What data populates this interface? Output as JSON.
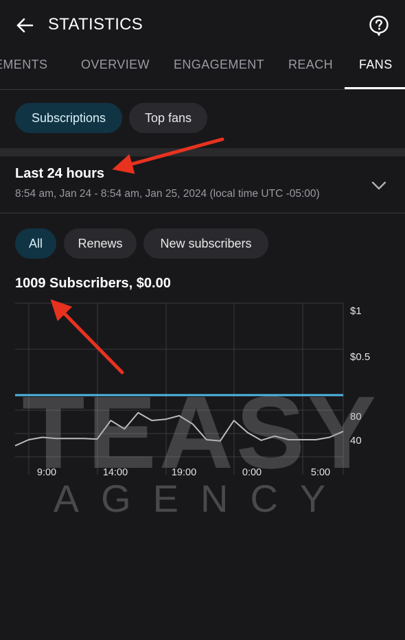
{
  "header": {
    "title": "STATISTICS",
    "back_icon": "arrow-left-icon",
    "help_icon": "question-bubble-icon"
  },
  "tabs": [
    {
      "label": "EMENTS",
      "active": false
    },
    {
      "label": "OVERVIEW",
      "active": false
    },
    {
      "label": "ENGAGEMENT",
      "active": false
    },
    {
      "label": "REACH",
      "active": false
    },
    {
      "label": "FANS",
      "active": true
    }
  ],
  "segments": [
    {
      "label": "Subscriptions",
      "active": true
    },
    {
      "label": "Top fans",
      "active": false
    }
  ],
  "period": {
    "title": "Last 24 hours",
    "subtitle": "8:54 am, Jan 24 - 8:54 am, Jan 25, 2024 (local time UTC -05:00)",
    "expand_icon": "chevron-down-icon"
  },
  "filters": [
    {
      "label": "All",
      "active": true
    },
    {
      "label": "Renews",
      "active": false
    },
    {
      "label": "New subscribers",
      "active": false
    }
  ],
  "summary": "1009 Subscribers, $0.00",
  "watermark": {
    "line1": "TEASY",
    "line2": "AGENCY"
  },
  "colors": {
    "background": "#18181b",
    "accent_chip": "#113444",
    "revenue_line": "#4fb6e3",
    "subscribers_line": "#bdbdbd",
    "annotation_arrow": "#e8321f"
  },
  "chart_data": {
    "type": "line",
    "x_tick_labels": [
      "9:00",
      "14:00",
      "19:00",
      "0:00",
      "5:00"
    ],
    "y_right_revenue_ticks": [
      "$1",
      "$0.5"
    ],
    "y_right_subscriber_ticks": [
      "80",
      "40"
    ],
    "series": [
      {
        "axis": "revenue",
        "color": "#4fb6e3",
        "values": [
          0,
          0,
          0,
          0,
          0,
          0,
          0,
          0,
          0,
          0,
          0,
          0,
          0,
          0,
          0,
          0,
          0,
          0,
          0,
          0,
          0,
          0,
          0,
          0,
          0
        ]
      },
      {
        "axis": "subscribers",
        "color": "#bdbdbd",
        "values": [
          30,
          40,
          44,
          42,
          42,
          42,
          41,
          72,
          58,
          85,
          72,
          74,
          80,
          66,
          40,
          38,
          72,
          52,
          39,
          46,
          40,
          40,
          40,
          44,
          54
        ]
      }
    ],
    "subscribers_range": [
      20,
      100
    ],
    "revenue_range": [
      0,
      1
    ],
    "grid": true
  }
}
